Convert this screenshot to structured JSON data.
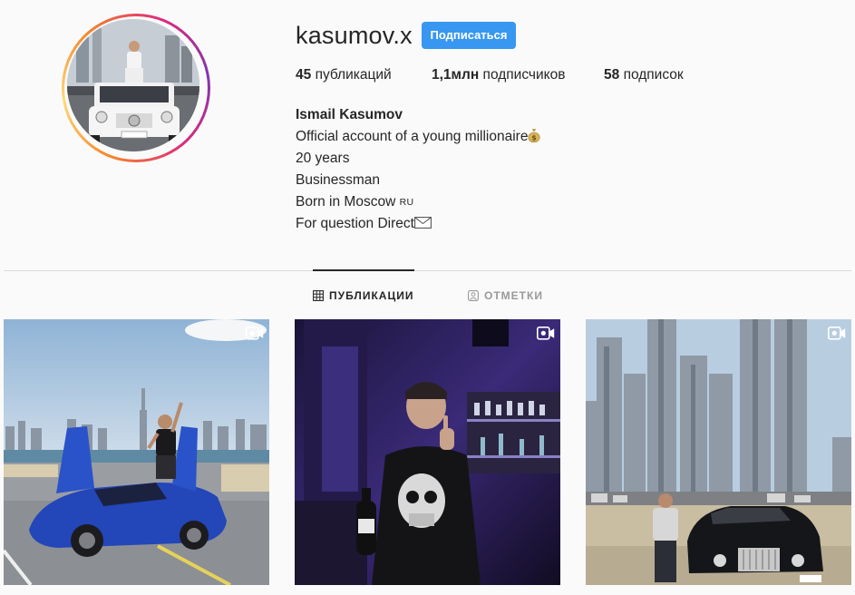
{
  "profile": {
    "username": "kasumov.x",
    "follow_label": "Подписаться",
    "stats": [
      {
        "count": "45",
        "label": "публикаций"
      },
      {
        "count": "1,1млн",
        "label": "подписчиков"
      },
      {
        "count": "58",
        "label": "подписок"
      }
    ],
    "bio": {
      "full_name": "Ismail Kasumov",
      "line1": "Official account of a young millionaire",
      "line2": "20 years",
      "line3": "Businessman",
      "line4": "Born in Moscow",
      "line4_flag": "RU",
      "line5": "For question Direct"
    }
  },
  "tabs": [
    {
      "label": "ПУБЛИКАЦИИ",
      "icon": "grid-icon",
      "active": true
    },
    {
      "label": "ОТМЕТКИ",
      "icon": "tagged-user-icon",
      "active": false
    }
  ],
  "posts": [
    {
      "type": "video",
      "subject": "man on blue sports car with raised doors",
      "icon": "video-icon"
    },
    {
      "type": "video",
      "subject": "man in skull shirt in purple-lit bar",
      "icon": "video-icon"
    },
    {
      "type": "video",
      "subject": "man beside black luxury car in front of skyscrapers",
      "icon": "video-icon"
    }
  ],
  "colors": {
    "accent": "#3897f0",
    "text": "#262626",
    "muted": "#999999",
    "divider": "#dbdbdb",
    "background": "#fafafa"
  }
}
